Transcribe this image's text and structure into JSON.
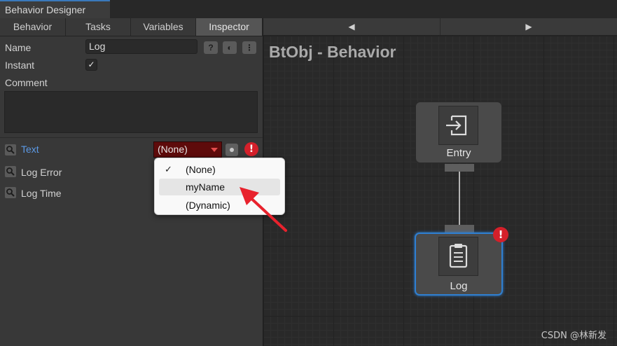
{
  "window": {
    "title": "Behavior Designer"
  },
  "tabs": [
    {
      "label": "Behavior",
      "active": false
    },
    {
      "label": "Tasks",
      "active": false
    },
    {
      "label": "Variables",
      "active": false
    },
    {
      "label": "Inspector",
      "active": true
    }
  ],
  "nav": {
    "prev": "◀",
    "next": "▶"
  },
  "inspector": {
    "name_label": "Name",
    "name_value": "Log",
    "instant_label": "Instant",
    "instant_checked": true,
    "comment_label": "Comment",
    "comment_value": "",
    "buttons": [
      "?",
      "◐",
      "⋮"
    ],
    "fields": [
      {
        "label": "Text",
        "highlight": true,
        "value": "(None)",
        "has_error": true
      },
      {
        "label": "Log Error"
      },
      {
        "label": "Log Time"
      }
    ]
  },
  "dropdown_menu": {
    "items": [
      {
        "label": "(None)",
        "checked": true
      },
      {
        "label": "myName",
        "hovered": true
      },
      {
        "label": "(Dynamic)"
      }
    ]
  },
  "graph": {
    "title": "BtObj - Behavior",
    "nodes": [
      {
        "label": "Entry",
        "icon": "entry-icon",
        "selected": false,
        "error": false
      },
      {
        "label": "Log",
        "icon": "clipboard-icon",
        "selected": true,
        "error": true
      }
    ]
  },
  "watermark": "CSDN @林新发",
  "colors": {
    "accent": "#2f7fd1",
    "error": "#d4202a",
    "highlight_text": "#5c9ae6",
    "arrow": "#e8222d"
  }
}
